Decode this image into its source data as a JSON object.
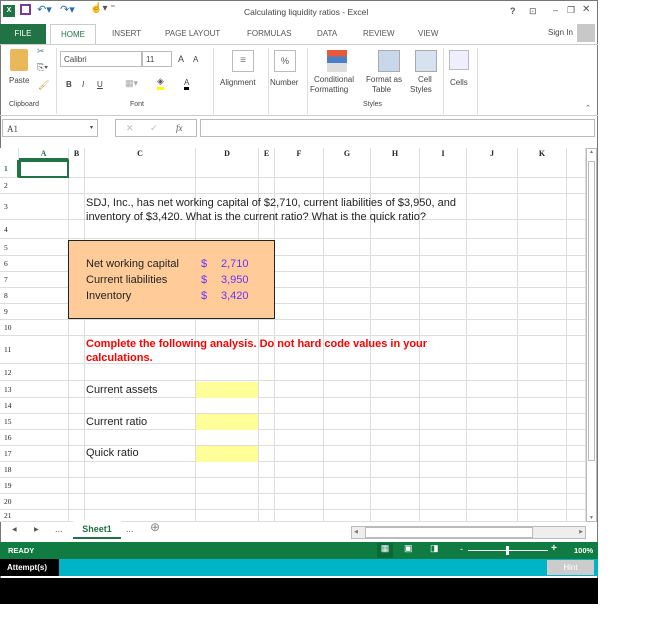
{
  "window": {
    "title": "Calculating liquidity ratios - Excel",
    "controls": [
      "?",
      "restore-ribbon",
      "minimize",
      "maximize",
      "close"
    ]
  },
  "tabs": {
    "file": "FILE",
    "items": [
      "HOME",
      "INSERT",
      "PAGE LAYOUT",
      "FORMULAS",
      "DATA",
      "REVIEW",
      "VIEW"
    ],
    "active": "HOME",
    "sign_in": "Sign In"
  },
  "ribbon": {
    "clipboard": {
      "paste": "Paste",
      "group": "Clipboard"
    },
    "font": {
      "name": "Calibri",
      "size": "11",
      "bold": "B",
      "italic": "I",
      "underline": "U",
      "group": "Font",
      "font_color": "A",
      "grow": "A",
      "shrink": "A"
    },
    "alignment": {
      "label": "Alignment"
    },
    "number": {
      "label": "Number",
      "icon_text": "%"
    },
    "styles": {
      "conditional_1": "Conditional",
      "conditional_2": "Formatting",
      "format_table_1": "Format as",
      "format_table_2": "Table",
      "cell_styles_1": "Cell",
      "cell_styles_2": "Styles",
      "group": "Styles"
    },
    "cells": {
      "label": "Cells"
    }
  },
  "formula_bar": {
    "name_box": "A1",
    "formula": "",
    "fx": "fx",
    "cancel": "✕",
    "enter": "✓"
  },
  "columns": [
    "A",
    "B",
    "C",
    "D",
    "E",
    "F",
    "G",
    "H",
    "I",
    "J",
    "K"
  ],
  "rows": [
    "1",
    "2",
    "3",
    "4",
    "5",
    "6",
    "7",
    "8",
    "9",
    "10",
    "11",
    "12",
    "13",
    "14",
    "15",
    "16",
    "17",
    "18",
    "19",
    "20",
    "21"
  ],
  "sheet": {
    "problem_line1": "SDJ, Inc., has net working capital of $2,710, current liabilities of $3,950, and",
    "problem_line2": "inventory of $3,420. What is the current ratio? What is the quick ratio?",
    "inputs": [
      {
        "label": "Net working capital",
        "currency": "$",
        "value": "2,710"
      },
      {
        "label": "Current liabilities",
        "currency": "$",
        "value": "3,950"
      },
      {
        "label": "Inventory",
        "currency": "$",
        "value": "3,420"
      }
    ],
    "instruction_line1": "Complete the following analysis. Do not hard code values in your",
    "instruction_line2": "calculations.",
    "analysis": [
      {
        "label": "Current assets",
        "value": ""
      },
      {
        "label": "Current ratio",
        "value": ""
      },
      {
        "label": "Quick ratio",
        "value": ""
      }
    ],
    "selected_cell": "A1"
  },
  "sheet_tabs": {
    "active": "Sheet1",
    "ellipsis": "..."
  },
  "status": {
    "mode": "READY",
    "zoom": "100%",
    "zoom_minus": "-",
    "zoom_plus": "+"
  },
  "bottom": {
    "attempts": "Attempt(s)",
    "hint": "Hint"
  },
  "colors": {
    "excel_green": "#217346",
    "status_green": "#107c41",
    "teal": "#00b4c8",
    "input_box": "#ffcc99",
    "input_value": "#6633ff",
    "instruction_red": "#ff0000",
    "answer_yellow": "#ffff99"
  }
}
